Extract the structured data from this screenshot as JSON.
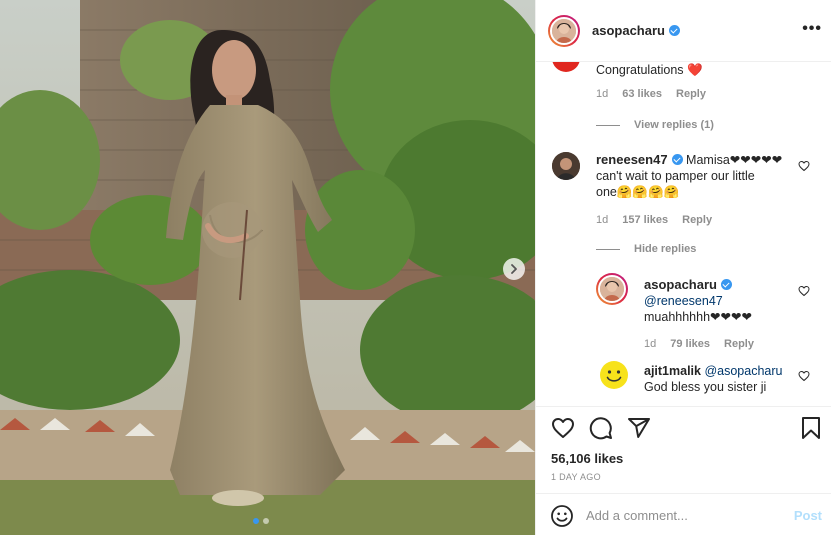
{
  "header": {
    "username": "asopacharu",
    "verified": true,
    "more_label": "•••"
  },
  "comments": [
    {
      "text": "Congratulations ❤️",
      "time": "1d",
      "likes": "63 likes",
      "reply_label": "Reply",
      "replies_toggle": "View replies (1)",
      "avatar_color": "#e0271f"
    },
    {
      "username": "reneesen47",
      "verified": true,
      "text_line1": "Mamisa❤❤❤❤❤",
      "text_line2": "can't wait to pamper our little",
      "text_line3": "one🤗🤗🤗🤗",
      "time": "1d",
      "likes": "157 likes",
      "reply_label": "Reply",
      "replies_toggle": "Hide replies"
    }
  ],
  "replies": [
    {
      "username": "asopacharu",
      "verified": true,
      "mention": "@reneesen47",
      "text": "muahhhhhh❤❤❤❤",
      "time": "1d",
      "likes": "79 likes",
      "reply_label": "Reply"
    },
    {
      "username": "ajit1malik",
      "mention": "@asopacharu",
      "text": "God bless you sister ji"
    }
  ],
  "post": {
    "likes": "56,106 likes",
    "time_ago": "1 DAY AGO"
  },
  "add_comment": {
    "placeholder": "Add a comment...",
    "post_label": "Post"
  },
  "icons": {
    "like": "heart-icon",
    "comment": "comment-icon",
    "share": "paper-plane-icon",
    "save": "bookmark-icon",
    "emoji": "smiley-icon",
    "carousel_next": "chevron-right-icon"
  },
  "colors": {
    "link": "#00376b",
    "verified": "#3897f0",
    "muted": "#8e8e8e",
    "post_disabled": "#b2dffc"
  },
  "carousel": {
    "slides": 2,
    "active": 1
  }
}
